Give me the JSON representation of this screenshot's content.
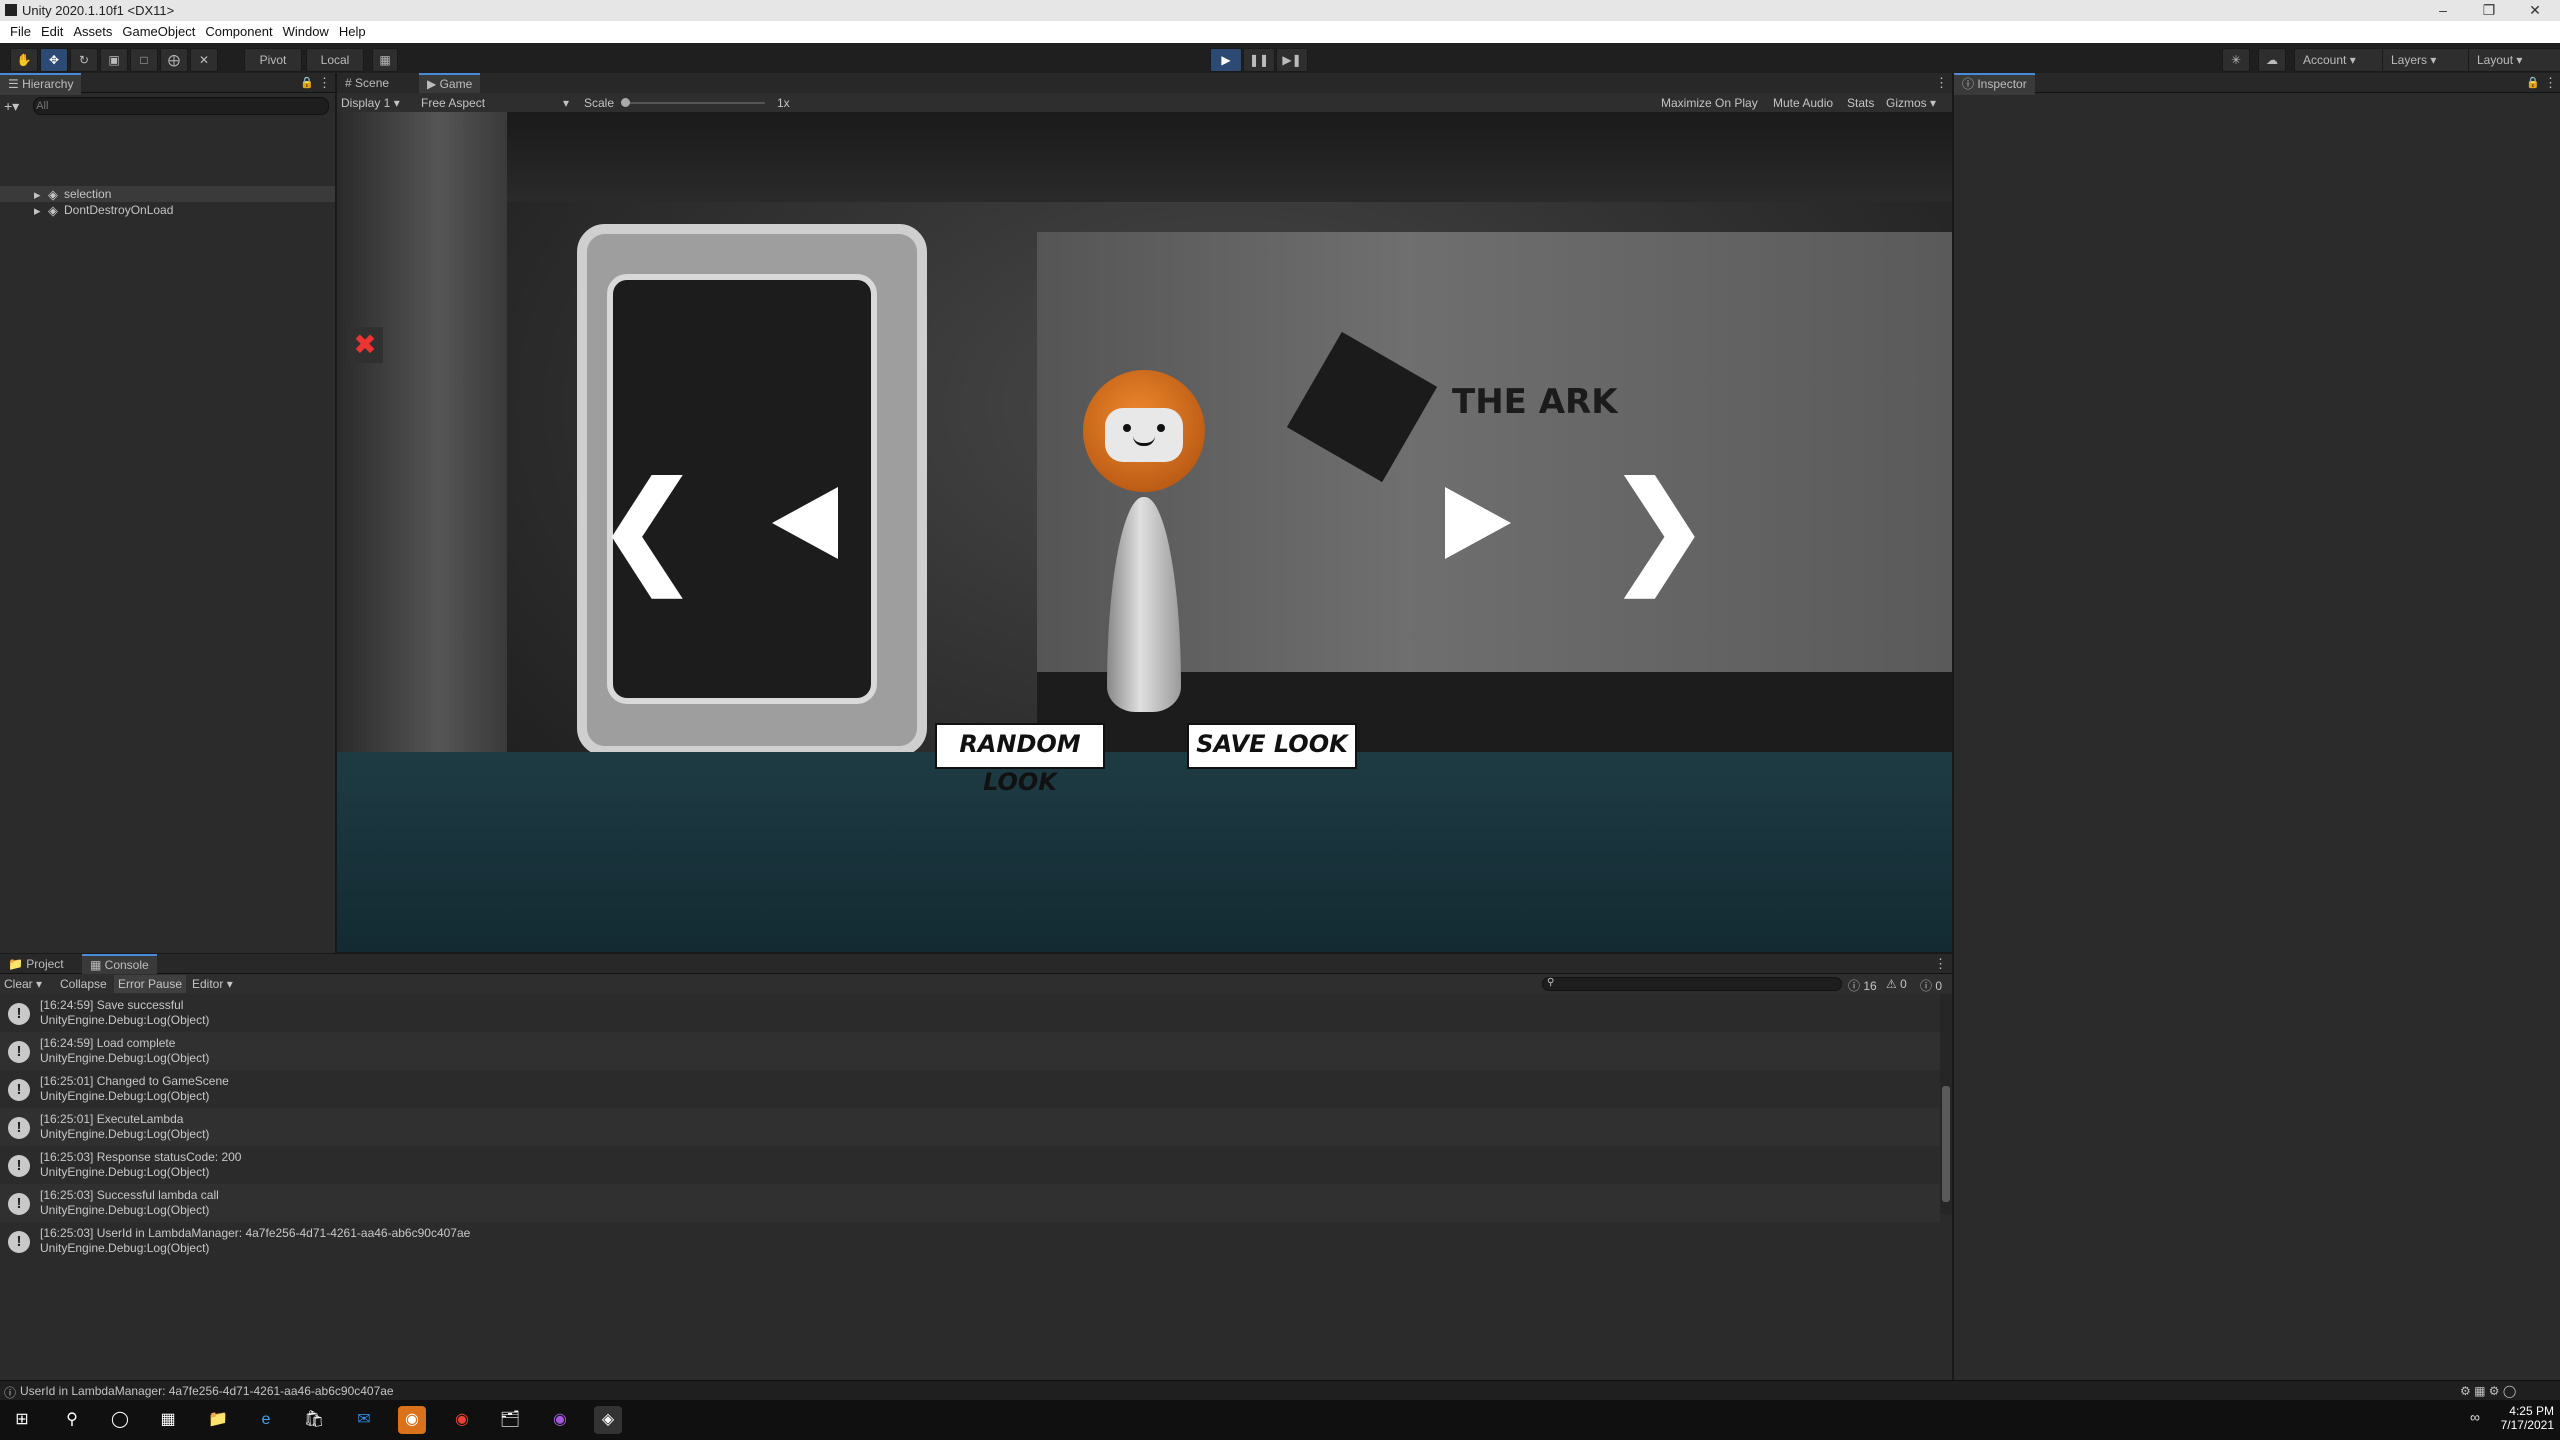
{
  "window": {
    "title": "Unity 2020.1.10f1 <DX11>"
  },
  "menu": [
    "File",
    "Edit",
    "Assets",
    "GameObject",
    "Component",
    "Window",
    "Help"
  ],
  "toolbar": {
    "pivot_label": "Pivot",
    "local_label": "Local",
    "account_label": "Account",
    "layers_label": "Layers",
    "layout_label": "Layout"
  },
  "hierarchy": {
    "tab_label": "Hierarchy",
    "search_placeholder": "All",
    "items": [
      "selection",
      "DontDestroyOnLoad"
    ]
  },
  "scene_tabs": {
    "scene": "Scene",
    "game": "Game"
  },
  "game_toolbar": {
    "display": "Display 1",
    "aspect": "Free Aspect",
    "scale_label": "Scale",
    "scale_value": "1x",
    "maximize": "Maximize On Play",
    "mute": "Mute Audio",
    "stats": "Stats",
    "gizmos": "Gizmos"
  },
  "game": {
    "brand_text": "THE ARK",
    "random_button": "RANDOM LOOK",
    "save_button": "SAVE LOOK"
  },
  "inspector": {
    "tab_label": "Inspector"
  },
  "bottom_tabs": {
    "project": "Project",
    "console": "Console"
  },
  "console_toolbar": {
    "clear": "Clear",
    "collapse": "Collapse",
    "error_pause": "Error Pause",
    "editor": "Editor",
    "info_count": "16",
    "warn_count": "0",
    "error_count": "0"
  },
  "console_logs": [
    {
      "line1": "[16:24:59] Save successful",
      "line2": "UnityEngine.Debug:Log(Object)"
    },
    {
      "line1": "[16:24:59] Load complete",
      "line2": "UnityEngine.Debug:Log(Object)"
    },
    {
      "line1": "[16:25:01] Changed to GameScene",
      "line2": "UnityEngine.Debug:Log(Object)"
    },
    {
      "line1": "[16:25:01] ExecuteLambda",
      "line2": "UnityEngine.Debug:Log(Object)"
    },
    {
      "line1": "[16:25:03] Response statusCode: 200",
      "line2": "UnityEngine.Debug:Log(Object)"
    },
    {
      "line1": "[16:25:03] Successful lambda call",
      "line2": "UnityEngine.Debug:Log(Object)"
    },
    {
      "line1": "[16:25:03] UserId in LambdaManager: 4a7fe256-4d71-4261-aa46-ab6c90c407ae",
      "line2": "UnityEngine.Debug:Log(Object)"
    }
  ],
  "status_bar": {
    "text": "UserId in LambdaManager: 4a7fe256-4d71-4261-aa46-ab6c90c407ae"
  },
  "taskbar": {
    "time": "4:25 PM",
    "date": "7/17/2021"
  }
}
